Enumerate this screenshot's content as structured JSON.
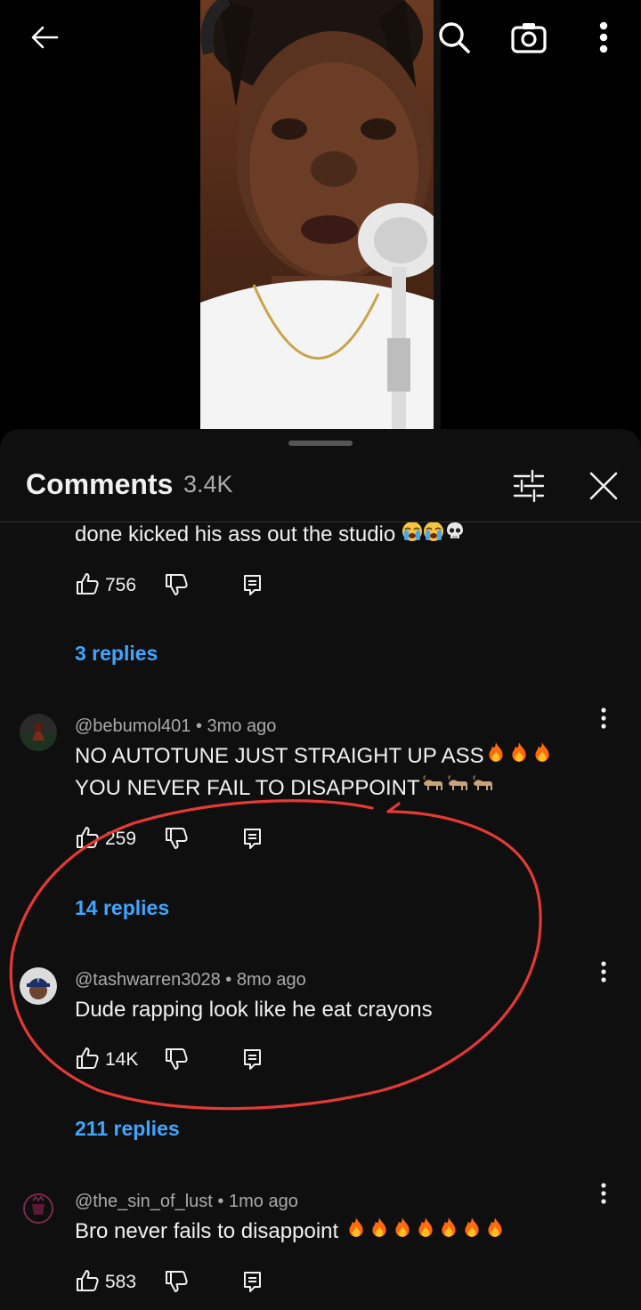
{
  "header": {
    "title": "Comments",
    "count": "3.4K"
  },
  "top_icons": [
    "back-arrow-icon",
    "search-icon",
    "camera-icon",
    "more-vert-icon"
  ],
  "colors": {
    "accent_link": "#3ea6ff",
    "annotation": "#e53935",
    "sheet_bg": "#0f0f0f"
  },
  "comments": [
    {
      "partial": true,
      "text": "done kicked his ass out the studio",
      "emojis": [
        "loudly-crying-face",
        "loudly-crying-face",
        "skull"
      ],
      "likes": "756",
      "replies": "3 replies"
    },
    {
      "author": "@bebumol401",
      "time": "3mo ago",
      "text_line1": "NO AUTOTUNE JUST STRAIGHT UP ASS",
      "text_line2": "YOU NEVER FAIL TO DISAPPOINT",
      "emojis_line1": [
        "fire",
        "fire",
        "fire"
      ],
      "emojis_line2": [
        "goat",
        "goat",
        "goat"
      ],
      "likes": "259",
      "replies": "14 replies"
    },
    {
      "author": "@tashwarren3028",
      "time": "8mo ago",
      "text": "Dude rapping look like he eat crayons",
      "likes": "14K",
      "replies": "211 replies",
      "highlighted": true
    },
    {
      "author": "@the_sin_of_lust",
      "time": "1mo ago",
      "text": "Bro never fails to disappoint",
      "emojis": [
        "fire",
        "fire",
        "fire",
        "fire",
        "fire",
        "fire",
        "fire"
      ],
      "likes": "583"
    }
  ]
}
